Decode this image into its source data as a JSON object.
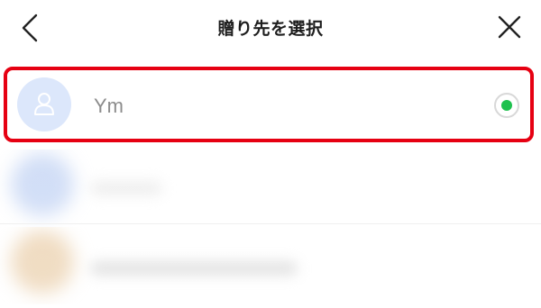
{
  "header": {
    "title": "贈り先を選択",
    "back_icon": "chevron-left-icon",
    "close_icon": "close-icon"
  },
  "recipients": [
    {
      "name": "Ym",
      "avatar_icon": "person-icon",
      "selected": true
    }
  ],
  "colors": {
    "selected_radio": "#1ec14e",
    "highlight_border": "#e60012",
    "avatar_bg": "#dce7fb"
  }
}
